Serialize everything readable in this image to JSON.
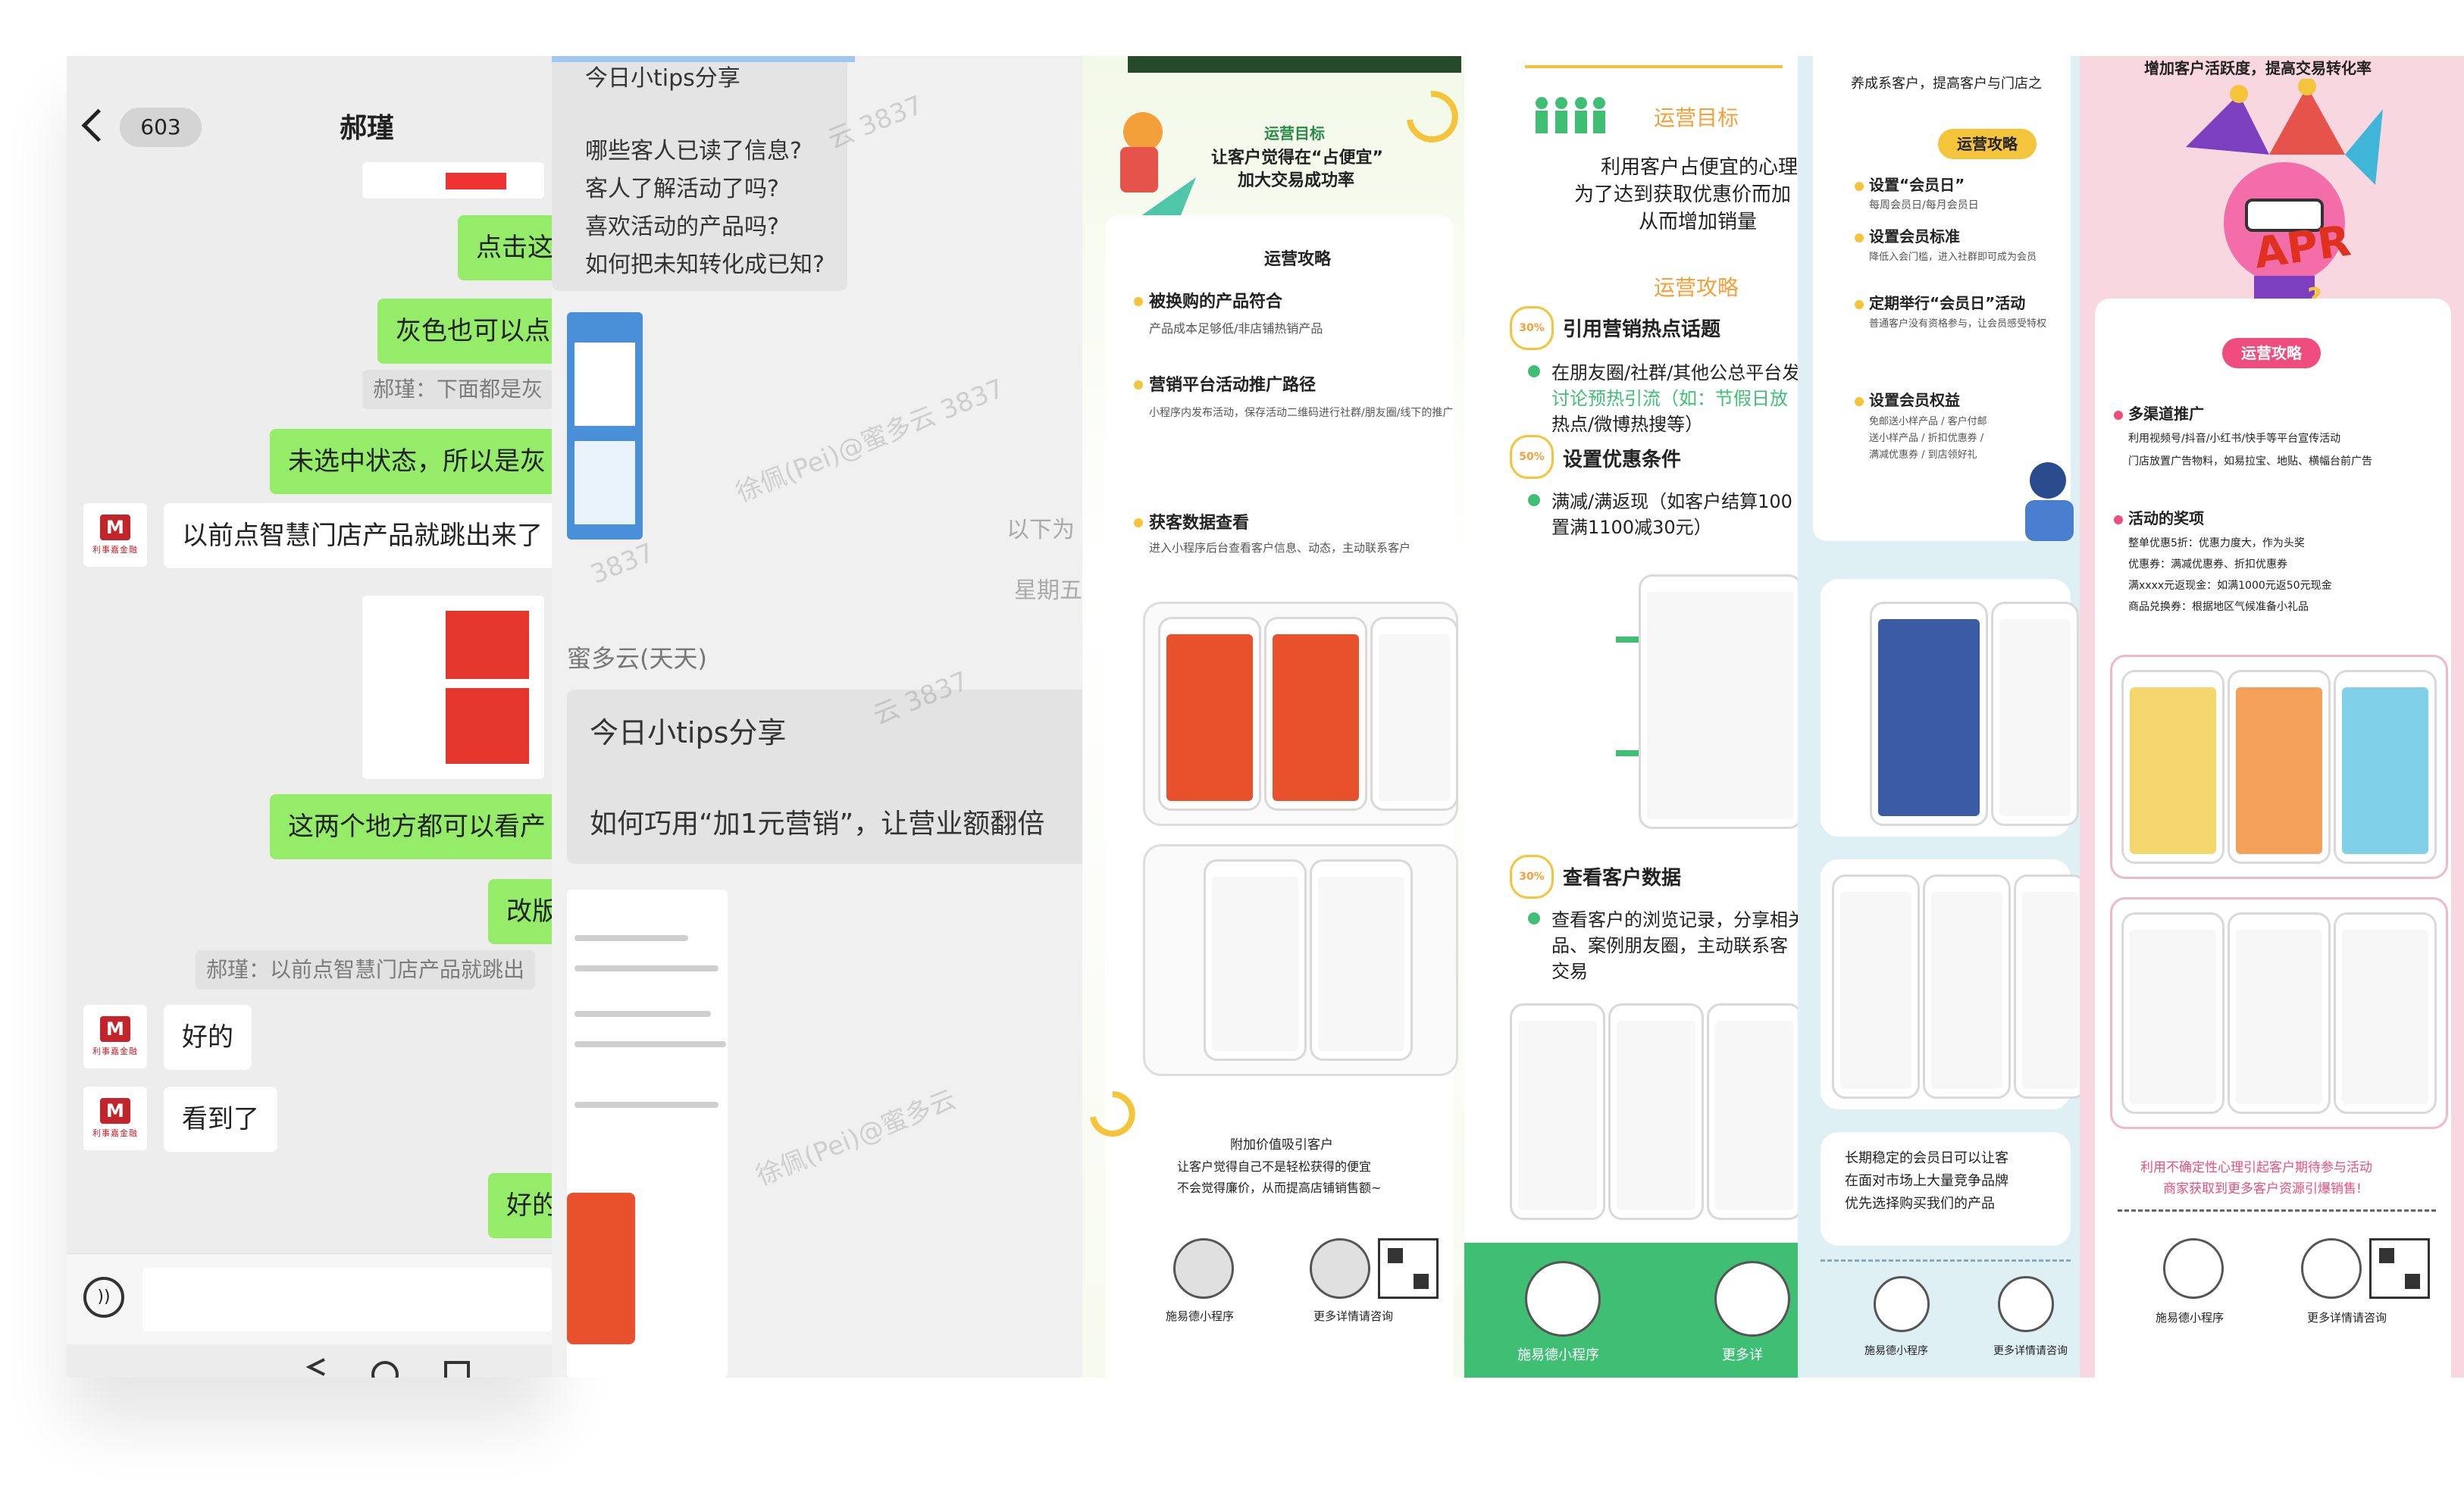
{
  "chat": {
    "unread_count": "603",
    "title": "郝瑾",
    "messages": [
      "点击这",
      "灰色也可以点",
      "郝瑾：下面都是灰",
      "未选中状态，所以是灰",
      "以前点智慧门店产品就跳出来了",
      "这两个地方都可以看产",
      "改版",
      "郝瑾：以前点智慧门店产品就跳出",
      "好的",
      "看到了",
      "好的"
    ],
    "avatar_brand": "利事嘉金融",
    "avatar_logo": "M"
  },
  "tips": {
    "header": "今日小tips分享",
    "questions": [
      "哪些客人已读了信息?",
      "客人了解活动了吗?",
      "喜欢活动的产品吗?",
      "如何把未知转化成已知?"
    ],
    "side_text": [
      "以下为",
      "星期五"
    ],
    "sender": "蜜多云(天天)",
    "card_title": "今日小tips分享",
    "card_body": "如何巧用“加1元营销”，让营业额翻倍",
    "watermarks": [
      "云 3837",
      "徐佩(Pei)@蜜多云 3837",
      "3837",
      "云 3837",
      "徐佩(Pei)@蜜多云"
    ]
  },
  "poster1": {
    "banner": "运营目标",
    "goal": "让客户觉得在“占便宜”",
    "goal2": "加大交易成功率",
    "strategy_title": "运营攻略",
    "items": [
      {
        "title": "被换购的产品符合",
        "desc": "产品成本足够低/非店铺热销产品"
      },
      {
        "title": "营销平台活动推广路径",
        "desc": "小程序内发布活动，保存活动二维码进行社群/朋友圈/线下的推广"
      },
      {
        "title": "获客数据查看",
        "desc": "进入小程序后台查看客户信息、动态，主动联系客户"
      }
    ],
    "bottom_title": "附加价值吸引客户",
    "bottom_desc1": "让客户觉得自己不是轻松获得的便宜",
    "bottom_desc2": "不会觉得廉价，从而提高店铺销售额~",
    "qr_label_1": "施易德小程序",
    "qr_label_2": "更多详情请咨询"
  },
  "poster2": {
    "goal_title": "运营目标",
    "goal_lines": [
      "利用客户占便宜的心理",
      "为了达到获取优惠价而加",
      "从而增加销量"
    ],
    "strategy_title": "运营攻略",
    "step1_badge": "30%",
    "step1": "引用营销热点话题",
    "step1_desc1": "在朋友圈/社群/其他公总平台发",
    "step1_desc2": "讨论预热引流（如：节假日放",
    "step1_desc3": "热点/微博热搜等）",
    "step2_badge": "50%",
    "step2": "设置优惠条件",
    "step2_desc1": "满减/满返现（如客户结算100",
    "step2_desc2": "置满1100减30元）",
    "step3_badge": "30%",
    "step3": "查看客户数据",
    "step3_desc1": "查看客户的浏览记录，分享相关",
    "step3_desc2": "品、案例朋友圈，主动联系客",
    "step3_desc3": "交易",
    "qr_label_1": "施易德小程序",
    "qr_label_2": "更多详"
  },
  "poster3": {
    "top_text": "养成系客户，提高客户与门店之",
    "strategy_title": "运营攻略",
    "items": [
      {
        "title": "设置“会员日”",
        "desc": "每周会员日/每月会员日"
      },
      {
        "title": "设置会员标准",
        "desc": "降低入会门槛，进入社群即可成为会员"
      },
      {
        "title": "定期举行“会员日”活动",
        "desc": "普通客户没有资格参与，让会员感受特权"
      },
      {
        "title": "设置会员权益",
        "desc": "免邮送小样产品 / 客户付邮送小样产品 / 折扣优惠券 / 满减优惠券 / 到店领好礼"
      }
    ],
    "bottom_lines": [
      "长期稳定的会员日可以让客",
      "在面对市场上大量竞争品牌",
      "优先选择购买我们的产品"
    ],
    "qr_label_1": "施易德小程序",
    "qr_label_2": "更多详情请咨询"
  },
  "poster4": {
    "top_text": "增加客户活跃度，提高交易转化率",
    "hero_text": "APR",
    "strategy_badge": "运营攻略",
    "sec1_title": "多渠道推广",
    "sec1_lines": [
      "利用视频号/抖音/小红书/快手等平台宣传活动",
      "门店放置广告物料，如易拉宝、地贴、横幅台前广告"
    ],
    "sec2_title": "活动的奖项",
    "sec2_lines": [
      "整单优惠5折：优惠力度大，作为头奖",
      "优惠券：满减优惠券、折扣优惠券",
      "满xxxx元返现金：如满1000元返50元现金",
      "商品兑换券：根据地区气候准备小礼品"
    ],
    "bottom_lines": [
      "利用不确定性心理引起客户期待参与活动",
      "商家获取到更多客户资源引爆销售!"
    ],
    "qr_label_1": "施易德小程序",
    "qr_label_2": "更多详情请咨询"
  },
  "colors": {
    "chat_bg": "#ededed",
    "bubble_green": "#95ec69",
    "brand_red": "#c2242c",
    "poster1_orange": "#e8512c",
    "poster2_green": "#3fbf74",
    "poster3_blue": "#dff0f5",
    "poster4_pink": "#f9d7e1",
    "pill_pink": "#ef4d7d"
  }
}
